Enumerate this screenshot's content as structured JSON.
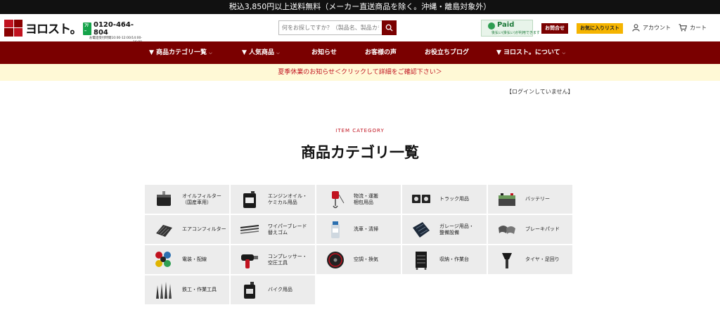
{
  "topbar": {
    "text": "税込3,850円以上送料無料（メーカー直送商品を除く。沖縄・離島対象外）"
  },
  "header": {
    "logo_text": "ヨロスト。",
    "tel_badge": "ﾌﾘｰ",
    "tel_number": "0120-464-804",
    "tel_hours": "お電話受付時間10:00-12:00/14:00-16:00\n(土日祝除く)",
    "search_placeholder": "何をお探しですか？（製品名、製品カテゴリ",
    "paid_logo": "Paid",
    "paid_sub": "後払い(掛払い)が利用できます",
    "contact_label": "お問合せ",
    "favorites_label": "お気に入りリスト",
    "account_label": "アカウント",
    "cart_label": "カート"
  },
  "nav": {
    "items": [
      {
        "label": "▼ 商品カテゴリ一覧",
        "has_dropdown": true
      },
      {
        "label": "▼ 人気商品",
        "has_dropdown": true
      },
      {
        "label": "お知らせ",
        "has_dropdown": false
      },
      {
        "label": "お客様の声",
        "has_dropdown": false
      },
      {
        "label": "お役立ちブログ",
        "has_dropdown": false
      },
      {
        "label": "▼ ヨロスト。について",
        "has_dropdown": true
      }
    ],
    "chevron": "⌵"
  },
  "notice": {
    "text": "夏季休業のお知らせ＜クリックして詳細をご確認下さい＞"
  },
  "login_status": "【ログインしていません】",
  "section": {
    "eyebrow": "ITEM CATEGORY",
    "title": "商品カテゴリ一覧"
  },
  "categories": [
    {
      "label": "オイルフィルター\n（国産車用）",
      "icon": "oil-filter-icon"
    },
    {
      "label": "エンジンオイル・\nケミカル用品",
      "icon": "oil-can-icon"
    },
    {
      "label": "物流・運搬\n梱包用品",
      "icon": "hoist-icon"
    },
    {
      "label": "トラック用品",
      "icon": "truck-lights-icon"
    },
    {
      "label": "バッテリー",
      "icon": "battery-icon"
    },
    {
      "label": "エアコンフィルター",
      "icon": "ac-filter-icon"
    },
    {
      "label": "ワイパーブレード\n替えゴム",
      "icon": "wiper-icon"
    },
    {
      "label": "洗車・清掃",
      "icon": "car-wash-icon"
    },
    {
      "label": "ガレージ用品・\n整備設備",
      "icon": "garage-mat-icon"
    },
    {
      "label": "ブレーキパッド",
      "icon": "brake-pad-icon"
    },
    {
      "label": "電装・配線",
      "icon": "wiring-icon"
    },
    {
      "label": "コンプレッサー・\n空圧工具",
      "icon": "impact-wrench-icon"
    },
    {
      "label": "空調・換気",
      "icon": "fan-icon"
    },
    {
      "label": "収納・作業台",
      "icon": "tool-cabinet-icon"
    },
    {
      "label": "タイヤ・足回り",
      "icon": "tire-valve-icon"
    },
    {
      "label": "鉄工・作業工具",
      "icon": "drill-bits-icon"
    },
    {
      "label": "バイク用品",
      "icon": "bike-oil-icon"
    }
  ],
  "colors": {
    "brand": "#7a0000",
    "accent_red": "#c1121f",
    "favorite_yellow": "#f5b400",
    "notice_bg": "#fff9d6",
    "cell_bg": "#ececec"
  }
}
